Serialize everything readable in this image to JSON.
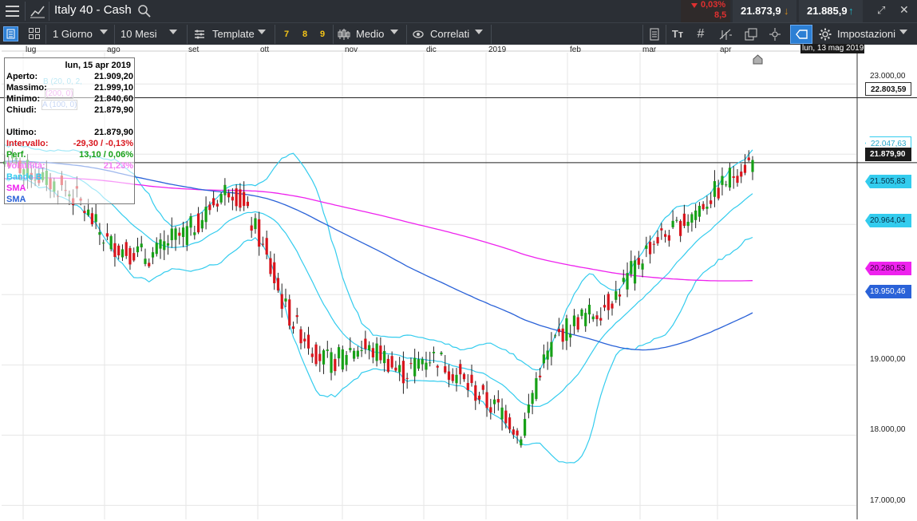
{
  "header": {
    "title": "Italy 40 - Cash",
    "change_pct": "0,03%",
    "change_pts": "8,5",
    "sell_price": "21.873,9",
    "buy_price": "21.885,9"
  },
  "toolbar": {
    "interval": "1 Giorno",
    "range": "10 Mesi",
    "template": "Template",
    "quick1": "7",
    "quick2": "8",
    "quick3": "9",
    "price_type": "Medio",
    "related": "Correlati",
    "settings": "Impostazioni"
  },
  "chart_data": {
    "type": "candlestick",
    "instrument": "Italy 40 - Cash",
    "x_labels": [
      "lug",
      "ago",
      "set",
      "ott",
      "nov",
      "dic",
      "2019",
      "feb",
      "mar",
      "apr"
    ],
    "x_end_label": "lun, 13 mag 2019",
    "y_ticks": [
      "23.000,00",
      "19.000,00",
      "18.000,00",
      "17.000,00"
    ],
    "ylim": [
      16800,
      23400
    ],
    "hline_value": 22803.59,
    "close_line_value": 21879.9,
    "colors": {
      "up": "#16a016",
      "down": "#d8141c",
      "bollinger": "#33ccee",
      "sma200": "#ee22ee",
      "sma100": "#2a62d8"
    },
    "close_series": [
      21900,
      21910,
      21870,
      21850,
      21820,
      21790,
      21760,
      21740,
      21710,
      21680,
      21650,
      21620,
      21590,
      21560,
      21540,
      21510,
      21480,
      21450,
      21400,
      21350,
      21290,
      21210,
      21130,
      21050,
      20980,
      20900,
      20820,
      20760,
      20720,
      20700,
      20680,
      20650,
      20620,
      20600,
      20620,
      20600,
      20580,
      20560,
      20550,
      20570,
      20600,
      20650,
      20700,
      20760,
      20800,
      20830,
      20820,
      20860,
      20900,
      20950,
      21000,
      21050,
      21100,
      21170,
      21240,
      21300,
      21370,
      21430,
      21480,
      21520,
      21500,
      21420,
      21330,
      21220,
      21110,
      21010,
      20930,
      20800,
      20650,
      20500,
      20350,
      20200,
      20050,
      19920,
      19800,
      19700,
      19600,
      19520,
      19460,
      19400,
      19330,
      19250,
      19180,
      19120,
      19080,
      19050,
      19040,
      19060,
      19100,
      19150,
      19200,
      19230,
      19250,
      19260,
      19240,
      19220,
      19200,
      19190,
      19180,
      19160,
      19120,
      19050,
      18980,
      18920,
      18900,
      18880,
      18900,
      18950,
      19000,
      19050,
      19100,
      19120,
      19120,
      19110,
      19100,
      19050,
      19000,
      18950,
      18900,
      18860,
      18800,
      18740,
      18700,
      18650,
      18600,
      18560,
      18500,
      18450,
      18420,
      18400,
      18380,
      18360,
      18300,
      18200,
      18120,
      18000,
      18050,
      18200,
      18400,
      18600,
      18800,
      18950,
      19050,
      19150,
      19250,
      19350,
      19420,
      19480,
      19520,
      19560,
      19600,
      19640,
      19680,
      19700,
      19720,
      19740,
      19760,
      19800,
      19850,
      19900,
      19950,
      20000,
      20080,
      20150,
      20230,
      20320,
      20400,
      20480,
      20560,
      20630,
      20700,
      20750,
      20800,
      20820,
      20850,
      20880,
      20900,
      20950,
      21000,
      21050,
      21100,
      21150,
      21200,
      21250,
      21300,
      21350,
      21400,
      21450,
      21500,
      21560,
      21620,
      21680,
      21720,
      21760,
      21800,
      21840,
      21870,
      21879.9
    ],
    "series": [
      {
        "name": "Bande B"
      },
      {
        "name": "SMA"
      },
      {
        "name": "SMA"
      }
    ],
    "price_badges": [
      {
        "value": "22.803,59",
        "style": "plain"
      },
      {
        "value": "22.047,63",
        "style": "bollinger"
      },
      {
        "value": "21.879,90",
        "style": "last"
      },
      {
        "value": "21.505,83",
        "style": "bollinger"
      },
      {
        "value": "20.964,04",
        "style": "bollinger"
      },
      {
        "value": "20.280,53",
        "style": "sma200"
      },
      {
        "value": "19.950,46",
        "style": "sma100"
      }
    ]
  },
  "info_panel": {
    "date": "lun, 15 apr 2019",
    "rows": [
      {
        "label": "Aperto:",
        "value": "21.909,20"
      },
      {
        "label": "Massimo:",
        "value": "21.999,10"
      },
      {
        "label": "Minimo:",
        "value": "21.840,60"
      },
      {
        "label": "Chiudi:",
        "value": "21.879,90"
      }
    ],
    "last_label": "Ultimo:",
    "last_value": "21.879,90",
    "range_label": "Intervallo:",
    "range_value": "-29,30 / -0,13%",
    "perf_label": "Perf.",
    "perf_value": "13,10 / 0,06%",
    "vol_label": "Volatilità:",
    "vol_value": "21,23%",
    "legend_bb": "Bande B",
    "legend_sma1": "SMA",
    "legend_sma2": "SMA",
    "ghost_bb": "B (20, 0, 2,",
    "ghost_sma1": "(200, 0)",
    "ghost_sma2": "A (100, 0)"
  }
}
